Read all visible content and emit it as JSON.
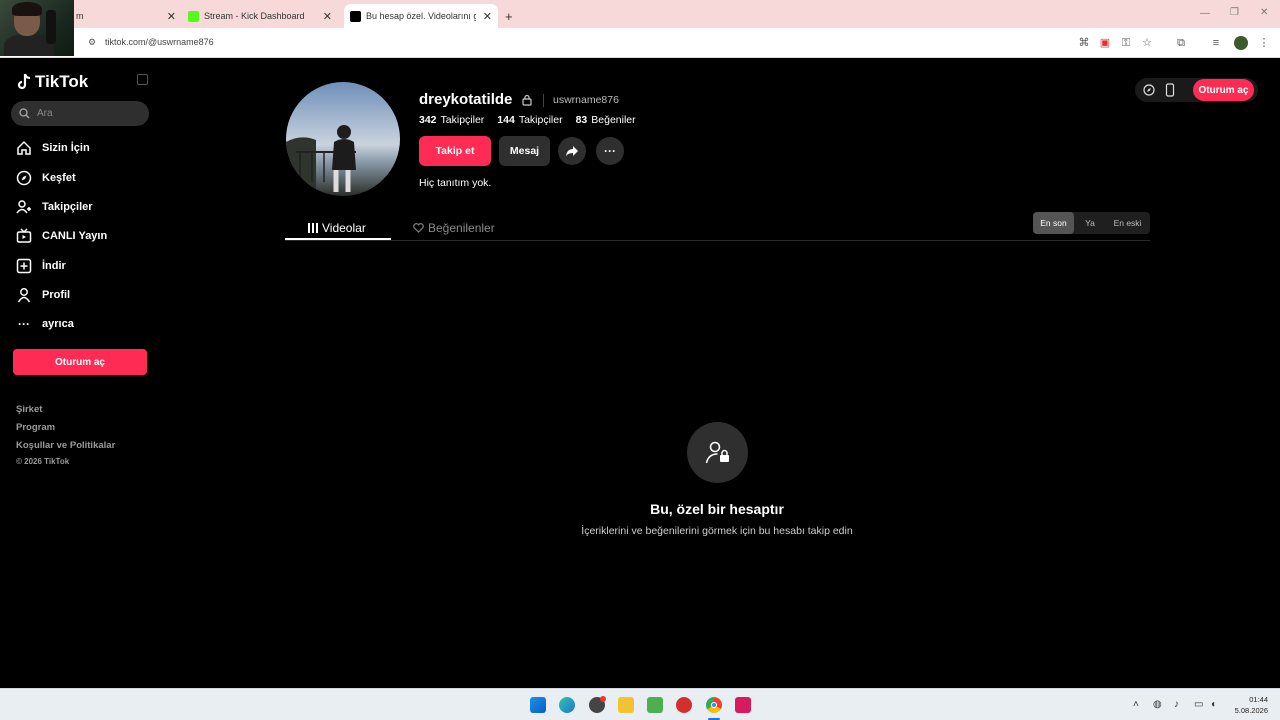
{
  "browser": {
    "tabs": [
      {
        "title": "m",
        "favicon_color": "#ffffff"
      },
      {
        "title": "Stream - Kick Dashboard",
        "favicon_color": "#53fc18"
      },
      {
        "title": "Bu hesap özel. Videolarını görm",
        "favicon_color": "#000000"
      }
    ],
    "url": "tiktok.com/@uswrname876",
    "new_tab_label": "+"
  },
  "sidebar": {
    "logo": "TikTok",
    "search_placeholder": "Ara",
    "items": [
      {
        "label": "Sizin İçin",
        "icon": "home-icon"
      },
      {
        "label": "Keşfet",
        "icon": "compass-icon"
      },
      {
        "label": "Takipçiler",
        "icon": "user-plus-icon"
      },
      {
        "label": "CANLI Yayın",
        "icon": "live-tv-icon"
      },
      {
        "label": "İndir",
        "icon": "plus-square-icon"
      },
      {
        "label": "Profil",
        "icon": "person-icon"
      },
      {
        "label": "ayrıca",
        "icon": "more-icon"
      }
    ],
    "login_label": "Oturum aç",
    "footer": [
      "Şirket",
      "Program",
      "Koşullar ve Politikalar",
      "© 2026 TikTok"
    ]
  },
  "profile": {
    "username": "dreykotatilde",
    "handle": "uswrname876",
    "following_count": "342",
    "following_label": "Takipçiler",
    "followers_count": "144",
    "followers_label": "Takipçiler",
    "likes_count": "83",
    "likes_label": "Beğeniler",
    "follow_label": "Takip et",
    "message_label": "Mesaj",
    "bio": "Hiç tanıtım yok."
  },
  "content_tabs": {
    "videos_label": "Videolar",
    "liked_label": "Beğenilenler",
    "sort_options": [
      "En son",
      "Ya",
      "En eski"
    ],
    "sort_selected": "En son"
  },
  "header": {
    "login_label": "Oturum aç"
  },
  "private_notice": {
    "title": "Bu, özel bir hesaptır",
    "subtitle": "İçeriklerini ve beğenilerini görmek için bu hesabı takip edin"
  },
  "taskbar": {
    "time": "01:44",
    "date": "5.08.2026"
  },
  "colors": {
    "accent": "#fe2c55",
    "background": "#000000",
    "surface": "#2f2f2f"
  }
}
